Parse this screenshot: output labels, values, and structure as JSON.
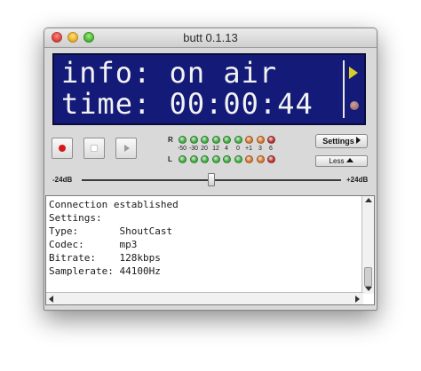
{
  "window": {
    "title": "butt 0.1.13"
  },
  "display": {
    "line1": "info: on air",
    "line2": "time: 00:00:44"
  },
  "controls": {
    "record": "record-button",
    "stop": "stop-button",
    "play": "play-button"
  },
  "vu_meter": {
    "labels": {
      "right": "R",
      "left": "L"
    },
    "ticks": [
      "-50",
      "-30",
      "20",
      "12",
      "4",
      "0",
      "+1",
      "3",
      "6"
    ],
    "led_colors": [
      "#3db33d",
      "#3db33d",
      "#3db33d",
      "#3db33d",
      "#3db33d",
      "#3db33d",
      "#e07a2a",
      "#e07a2a",
      "#c23030"
    ]
  },
  "buttons": {
    "settings_label": "Settings",
    "less_label": "Less"
  },
  "volume": {
    "min_label": "-24dB",
    "max_label": "+24dB",
    "level_fraction": 0.5
  },
  "log": [
    "Connection established",
    "Settings:",
    "Type:       ShoutCast",
    "Codec:      mp3",
    "Bitrate:    128kbps",
    "Samplerate: 44100Hz"
  ]
}
